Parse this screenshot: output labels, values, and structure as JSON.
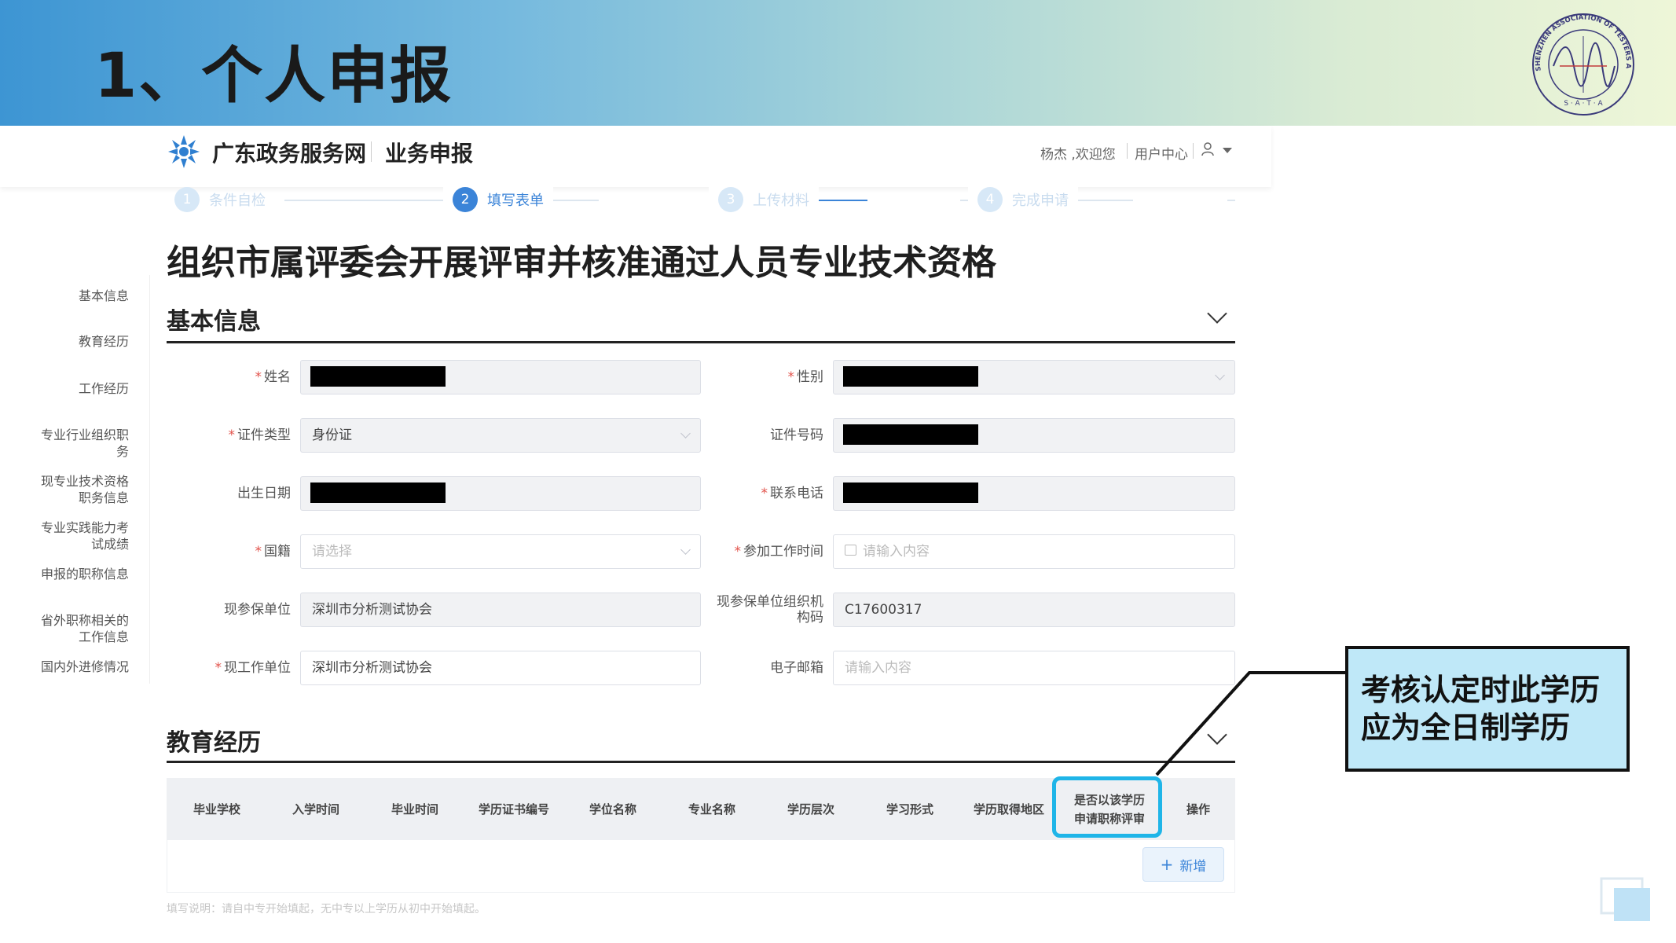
{
  "slide": {
    "title": "1、个人申报",
    "logo_text": "SHENZHEN ASSOCIATION OF TESTERS AND ANALYSIS",
    "logo_initials": "S · A · T · A"
  },
  "header": {
    "site_name": "广东政务服务网",
    "section": "业务申报",
    "welcome": "杨杰 ,欢迎您",
    "user_center": "用户中心"
  },
  "steps": [
    {
      "num": "1",
      "label": "条件自检",
      "active": false
    },
    {
      "num": "2",
      "label": "填写表单",
      "active": true
    },
    {
      "num": "3",
      "label": "上传材料",
      "active": false
    },
    {
      "num": "4",
      "label": "完成申请",
      "active": false
    }
  ],
  "page_title": "组织市属评委会开展评审并核准通过人员专业技术资格",
  "nav": [
    "基本信息",
    "教育经历",
    "工作经历",
    "专业行业组织职务",
    "现专业技术资格职务信息",
    "专业实践能力考试成绩",
    "申报的职称信息",
    "省外职称相关的工作信息",
    "国内外进修情况"
  ],
  "basic_info": {
    "title": "基本信息",
    "fields": {
      "name_label": "姓名",
      "gender_label": "性别",
      "id_type_label": "证件类型",
      "id_type_value": "身份证",
      "id_number_label": "证件号码",
      "birth_label": "出生日期",
      "phone_label": "联系电话",
      "nationality_label": "国籍",
      "nationality_placeholder": "请选择",
      "work_start_label": "参加工作时间",
      "work_start_placeholder": "请输入内容",
      "insured_unit_label": "现参保单位",
      "insured_unit_value": "深圳市分析测试协会",
      "org_code_label": "现参保单位组织机构码",
      "org_code_value": "C17600317",
      "work_unit_label": "现工作单位",
      "work_unit_value": "深圳市分析测试协会",
      "email_label": "电子邮箱",
      "email_placeholder": "请输入内容"
    }
  },
  "education": {
    "title": "教育经历",
    "columns": [
      "毕业学校",
      "入学时间",
      "毕业时间",
      "学历证书编号",
      "学位名称",
      "专业名称",
      "学历层次",
      "学习形式",
      "学历取得地区",
      "是否以该学历申请职称评审",
      "操作"
    ],
    "add_button": "新增",
    "note": "填写说明：请自中专开始填起，无中专以上学历从初中开始填起。"
  },
  "callout": {
    "text": "考核认定时此学历应为全日制学历"
  },
  "colors": {
    "accent": "#3b84d8",
    "highlight": "#1fb5e8",
    "callout_bg": "#bfe8f8",
    "required": "#e2524b"
  }
}
